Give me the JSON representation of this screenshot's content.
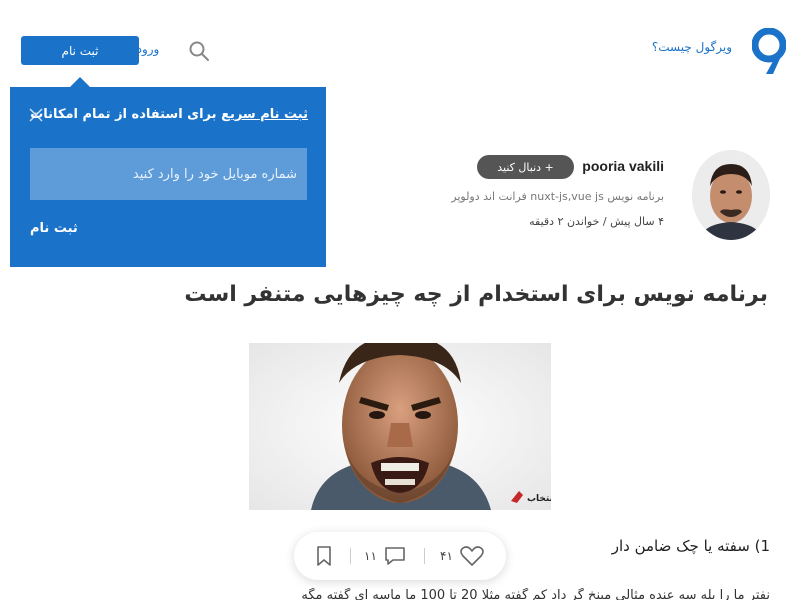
{
  "header": {
    "what_is_link": "ویرگول چیست؟",
    "login_label": "ورود",
    "signup_label": "ثبت نام"
  },
  "popup": {
    "title_emphasis": "ثبت نام سریع",
    "title_rest": " برای استفاده از تمام امکانات",
    "phone_placeholder": "شماره موبایل خود را وارد کنید",
    "submit_label": "ثبت نام"
  },
  "author": {
    "name": "pooria vakili",
    "follow_label": "+ دنبال کنید",
    "bio": "برنامه نویس nuxt-js,vue js فرانت اند دولوپر",
    "meta": "۴ سال پیش / خواندن ۲ دقیقه"
  },
  "post": {
    "title": "برنامه نویس برای استخدام از چه چیزهایی متنفر است",
    "image_watermark": "انتخاب",
    "section_heading": "1) سفته یا چک ضامن دار",
    "body_line": "نفتر ما را بله سه عنده مثالی مینخ گر داد کم گفته مثلا 20 تا 100 ما ماسه ای گفته مگه"
  },
  "actions": {
    "likes": "۴۱",
    "comments": "۱۱"
  },
  "colors": {
    "brand": "#1a73c9",
    "popup_input": "#5d9bd9",
    "follow_bg": "#555555"
  }
}
